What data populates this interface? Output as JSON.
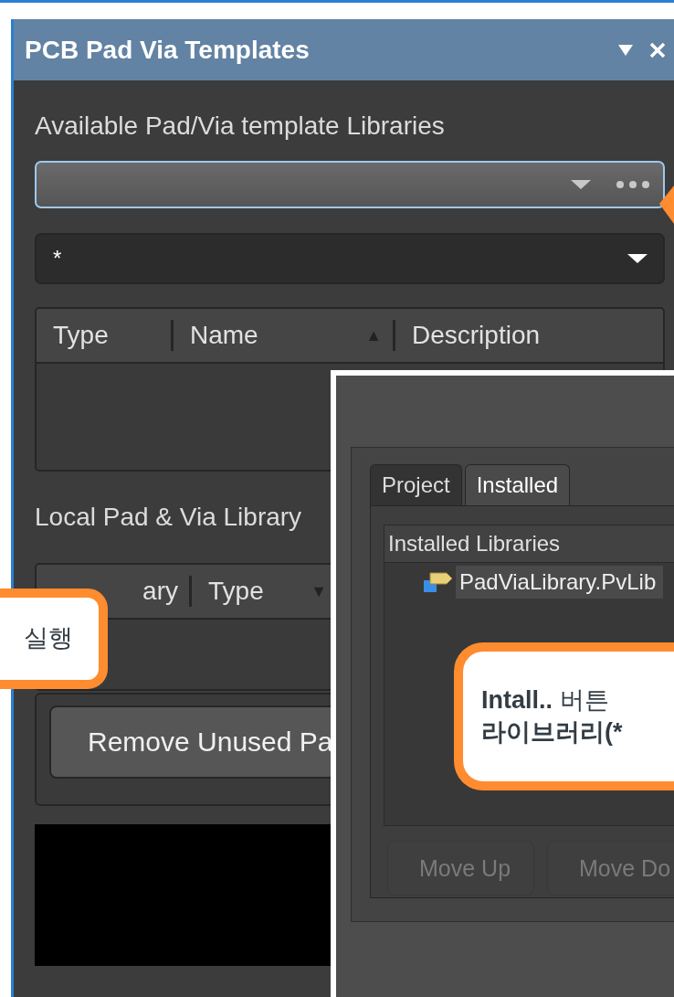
{
  "panel": {
    "title": "PCB Pad Via Templates"
  },
  "available_label": "Available Pad/Via template Libraries",
  "library_dropdown": {
    "focused": true
  },
  "filter": {
    "value": "*"
  },
  "templates_table": {
    "columns": [
      {
        "label": "Type"
      },
      {
        "label": "Name",
        "sort_arrow": "▲"
      },
      {
        "label": "Description"
      }
    ]
  },
  "local_label": "Local Pad & Via Library",
  "local_table": {
    "columns": [
      {
        "label": "ary"
      },
      {
        "label": "Type",
        "sort_arrow": "▼"
      }
    ]
  },
  "remove_button": {
    "label": "Remove Unused Pa"
  },
  "dialog": {
    "tabs": [
      {
        "label": "Project",
        "selected": false
      },
      {
        "label": "Installed",
        "selected": true
      }
    ],
    "list_header": "Installed Libraries",
    "libraries": [
      {
        "name": "PadViaLibrary.PvLib",
        "selected": true
      }
    ],
    "buttons": [
      {
        "label": "Move Up",
        "disabled": true
      },
      {
        "label": "Move Do",
        "disabled": true
      }
    ]
  },
  "callouts": [
    {
      "lines": [
        [
          {
            "text": "실행",
            "bold": false
          }
        ]
      ]
    },
    {
      "lines": [
        [
          {
            "text": "Intall..",
            "bold": true
          },
          {
            "text": " 버튼",
            "bold": false
          }
        ],
        [
          {
            "text": "라이브러리(*",
            "bold": true
          }
        ]
      ]
    }
  ]
}
